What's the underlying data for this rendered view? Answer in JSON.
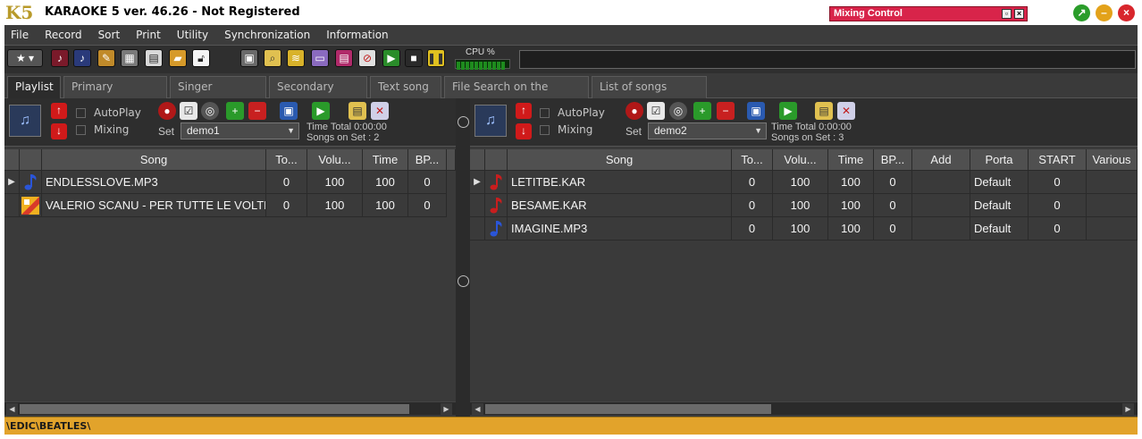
{
  "window": {
    "title": "KARAOKE 5   ver. 46.26 - Not Registered",
    "mixing_control": "Mixing Control"
  },
  "menu": [
    "File",
    "Record",
    "Sort",
    "Print",
    "Utility",
    "Synchronization",
    "Information"
  ],
  "toolbar": {
    "cpu_label": "CPU %"
  },
  "tabs": [
    "Playlist",
    "Primary Database",
    "Singer Schedule",
    "Secondary fields",
    "Text song",
    "File Search on the Internet",
    "List of songs played"
  ],
  "active_tab": "Playlist",
  "left_panel": {
    "autoplay_label": "AutoPlay",
    "mixing_label": "Mixing",
    "set_label": "Set",
    "set_value": "demo1",
    "time_total": "Time Total  0:00:00",
    "songs_on_set": "Songs on Set : 2",
    "columns": [
      "Song",
      "To...",
      "Volu...",
      "Time",
      "BP..."
    ],
    "rows": [
      {
        "song": "ENDLESSLOVE.MP3",
        "to": "0",
        "volume": "100",
        "time": "100",
        "bp": "0",
        "icon": "music-note-blue",
        "current": true
      },
      {
        "song": "VALERIO SCANU - PER TUTTE LE VOLTE",
        "to": "0",
        "volume": "100",
        "time": "100",
        "bp": "0",
        "icon": "video-file",
        "current": false
      }
    ]
  },
  "right_panel": {
    "autoplay_label": "AutoPlay",
    "mixing_label": "Mixing",
    "set_label": "Set",
    "set_value": "demo2",
    "time_total": "Time Total  0:00:00",
    "songs_on_set": "Songs on Set : 3",
    "columns": [
      "Song",
      "To...",
      "Volu...",
      "Time",
      "BP...",
      "Add",
      "Porta",
      "START",
      "Various"
    ],
    "rows": [
      {
        "song": "LETITBE.KAR",
        "to": "0",
        "volume": "100",
        "time": "100",
        "bp": "0",
        "add": "",
        "porta": "Default",
        "start": "0",
        "icon": "music-note-red",
        "current": true
      },
      {
        "song": "BESAME.KAR",
        "to": "0",
        "volume": "100",
        "time": "100",
        "bp": "0",
        "add": "",
        "porta": "Default",
        "start": "0",
        "icon": "music-note-red",
        "current": false
      },
      {
        "song": "IMAGINE.MP3",
        "to": "0",
        "volume": "100",
        "time": "100",
        "bp": "0",
        "add": "",
        "porta": "Default",
        "start": "0",
        "icon": "music-note-blue",
        "current": false
      }
    ]
  },
  "status_path": "\\EDIC\\BEATLES\\"
}
